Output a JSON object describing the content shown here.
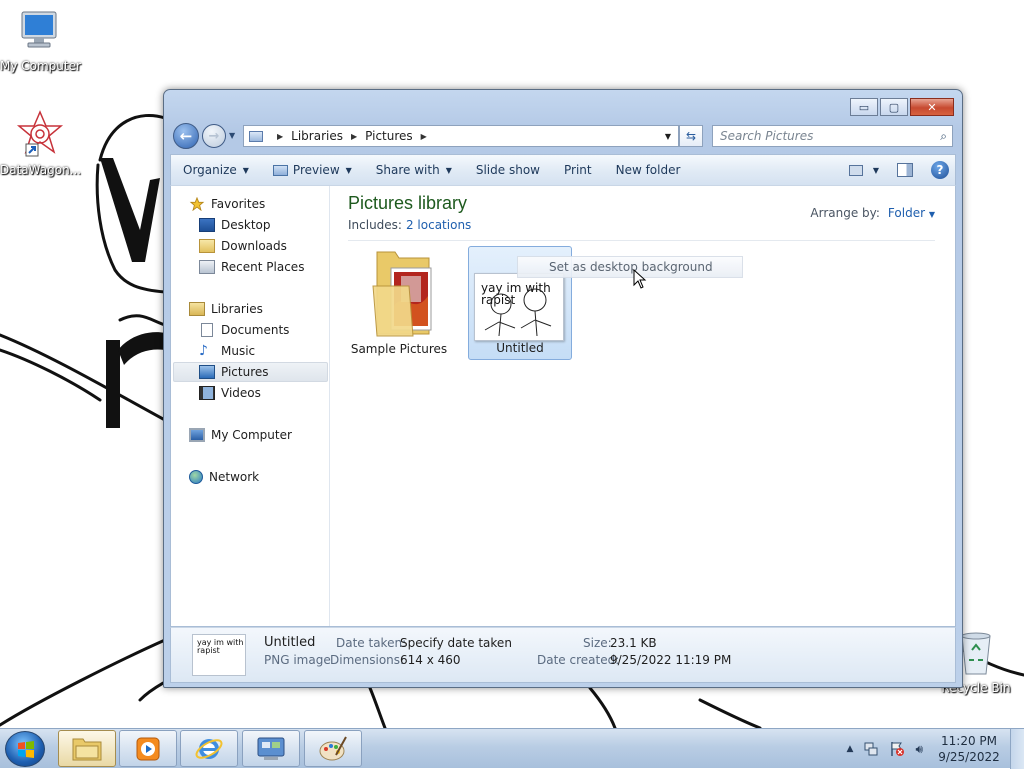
{
  "desktop": {
    "icons": [
      {
        "label": "My Computer"
      },
      {
        "label": "DataWagon..."
      },
      {
        "label": "Recycle Bin"
      }
    ]
  },
  "window": {
    "caption_buttons": {
      "minimize": "▭",
      "maximize": "▢",
      "close": "✕"
    },
    "breadcrumb": [
      "Libraries",
      "Pictures"
    ],
    "search_placeholder": "Search Pictures",
    "toolbar": {
      "organize": "Organize",
      "preview": "Preview",
      "share_with": "Share with",
      "slide_show": "Slide show",
      "print": "Print",
      "new_folder": "New folder",
      "help": "?"
    },
    "nav": {
      "favorites": "Favorites",
      "desktop": "Desktop",
      "downloads": "Downloads",
      "recent_places": "Recent Places",
      "libraries": "Libraries",
      "documents": "Documents",
      "music": "Music",
      "pictures": "Pictures",
      "videos": "Videos",
      "my_computer": "My Computer",
      "network": "Network"
    },
    "library": {
      "title": "Pictures library",
      "includes_label": "Includes:",
      "includes_link": "2 locations",
      "arrange_label": "Arrange by:",
      "arrange_value": "Folder"
    },
    "items": [
      {
        "caption": "Sample Pictures"
      },
      {
        "caption": "Untitled",
        "thumb_line1": "yay im with",
        "thumb_line2": "rapist"
      }
    ],
    "tooltip": "Set as desktop background",
    "details": {
      "name": "Untitled",
      "type": "PNG image",
      "date_taken_label": "Date taken:",
      "date_taken_value": "Specify date taken",
      "dimensions_label": "Dimensions:",
      "dimensions_value": "614 x 460",
      "size_label": "Size:",
      "size_value": "23.1 KB",
      "date_created_label": "Date created:",
      "date_created_value": "9/25/2022 11:19 PM",
      "thumb_line1": "yay im with",
      "thumb_line2": "rapist"
    }
  },
  "taskbar": {
    "clock_time": "11:20 PM",
    "clock_date": "9/25/2022"
  },
  "colors": {
    "library_title": "#1e5a1e",
    "link": "#1f5fae",
    "selection": "#c5ddf6"
  }
}
